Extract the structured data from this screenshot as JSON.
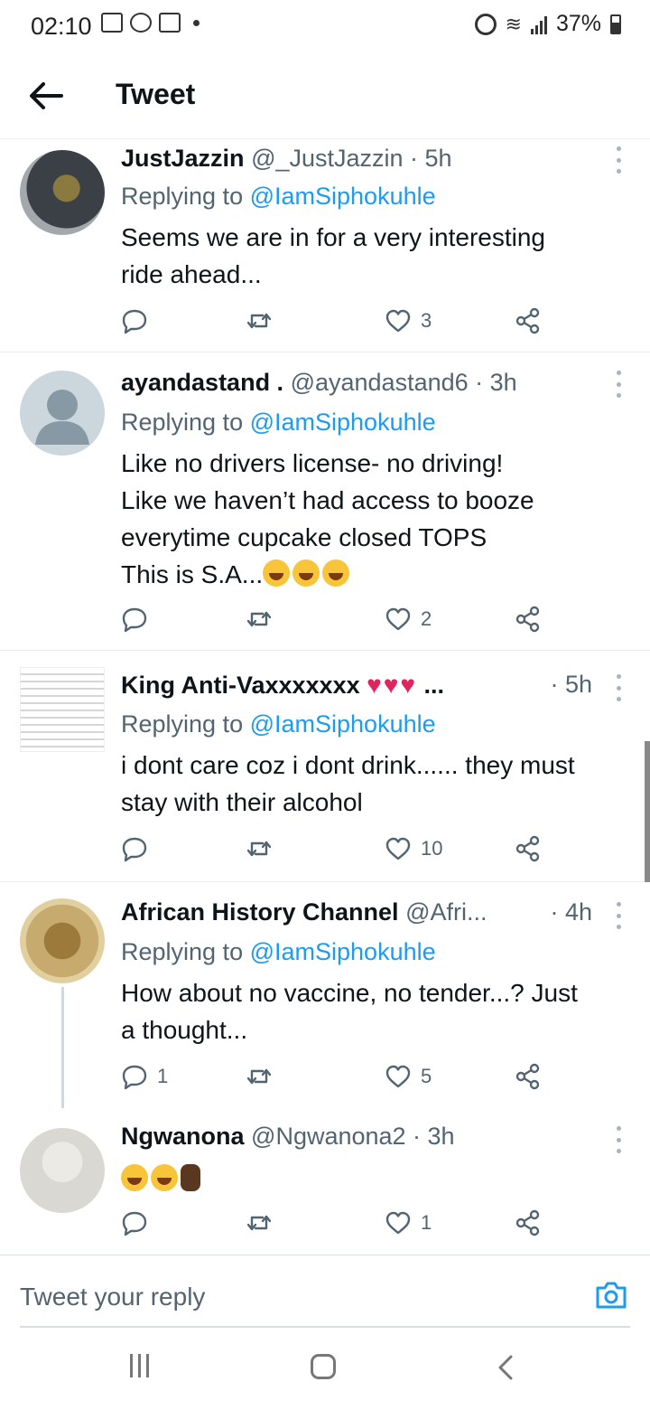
{
  "status_bar": {
    "time": "02:10",
    "battery": "37%"
  },
  "header": {
    "title": "Tweet"
  },
  "tweets": [
    {
      "name": "JustJazzin",
      "handle": "@_JustJazzin · 5h",
      "reply_prefix": "Replying to ",
      "reply_to": "@IamSiphokuhle",
      "lines": [
        "Seems we are in for a very interesting",
        "ride ahead..."
      ],
      "replies": "",
      "retweets": "",
      "likes": "3"
    },
    {
      "name": "ayandastand .",
      "handle": "@ayandastand6 · 3h",
      "reply_prefix": "Replying to ",
      "reply_to": "@IamSiphokuhle",
      "lines": [
        "Like no drivers license- no driving!",
        "Like we haven’t had access to booze",
        "everytime cupcake closed TOPS",
        "This is S.A..."
      ],
      "replies": "",
      "retweets": "",
      "likes": "2"
    },
    {
      "name": "King Anti-Vaxxxxxxx",
      "name_suffix": "...",
      "handle": "· 5h",
      "reply_prefix": "Replying to ",
      "reply_to": "@IamSiphokuhle",
      "lines": [
        "i dont care coz i dont drink...... they must",
        "stay with their alcohol"
      ],
      "replies": "",
      "retweets": "",
      "likes": "10"
    },
    {
      "name": "African History Channel",
      "handle": "@Afri...",
      "time": "· 4h",
      "reply_prefix": "Replying to ",
      "reply_to": "@IamSiphokuhle",
      "lines": [
        "How about no vaccine, no tender...? Just",
        "a thought..."
      ],
      "replies": "1",
      "retweets": "",
      "likes": "5"
    },
    {
      "name": "Ngwanona",
      "handle": "@Ngwanona2 · 3h",
      "lines": [],
      "replies": "",
      "retweets": "",
      "likes": "1"
    }
  ],
  "reply_box": {
    "placeholder": "Tweet your reply"
  },
  "colors": {
    "link": "#1d9bf0",
    "secondary_text": "#536471",
    "primary_text": "#0f1419"
  }
}
